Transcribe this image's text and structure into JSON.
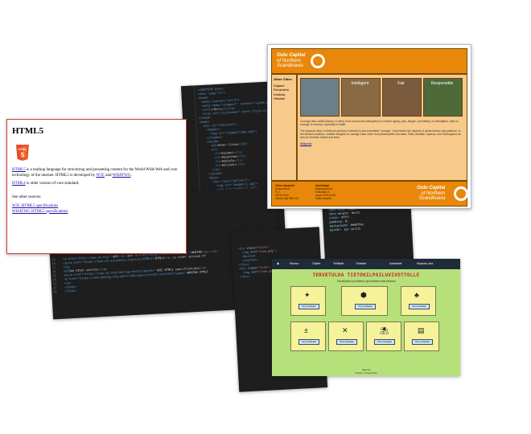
{
  "code_back": {
    "lines": [
      "<!DOCTYPE html>",
      "<html lang=\"fi\">",
      "<head>",
      "  <meta charset=\"utf-8\">",
      "  <meta name=\"viewport\" content=\"width=device-width\">",
      "  <title>Oulu</title>",
      "  <link rel=\"stylesheet\" href=\"style.css\">",
      "</head>",
      "<body>",
      "  <div id=\"container\">",
      "    <header>",
      "      <img src=\"images/logo.png\">",
      "    </header>",
      "    <aside>",
      "      <h2>Other Cities</h2>",
      "      <ul>",
      "        <li>Kajaani</li>",
      "        <li>Rovaniemi</li>",
      "        <li>Kokkola</li>",
      "        <li>Helsinki</li>",
      "      </ul>",
      "    </aside>",
      "    <main>",
      "      <div class=\"gallery\">",
      "        <img src=\"images/1.jpg\">",
      "        <img src=\"images/2.jpg\">",
      "      </div>",
      "    </main>",
      "  </div>",
      "</body>",
      "</html>"
    ]
  },
  "code_front": {
    "lines": [
      "<a href=\"http://www.w3.org/\">W3C</a> and <a href=\"http://www.whatwg.org/\">WHATWG</a>.</p>",
      "<p><a href=\"https://www.en.wikipedia.org/wiki/HTML4\">HTML4</a> is older version of",
      "</p>",
      "<p>See other sources:</p>",
      "<p><a href=\"https://www.w3.org/html/wg/drafts/master\">W3C HTML5 specifications</a>",
      "<a href=\"https://www.whatwg.org/specs/web-apps/current-work/multipage\">WHATWG HTML5",
      "</p>",
      "</body>",
      "</html>"
    ],
    "numbers": [
      "15",
      "16",
      "17",
      "18",
      "19",
      "20",
      "21",
      "22",
      "23"
    ]
  },
  "html5_doc": {
    "title": "HTML5",
    "para1_link": "HTML5",
    "para1": " is a markup language for structuring and presenting content for the World Wide Web and core technology of the internet. HTML5 is developed by ",
    "w3c": "W3C",
    "and": " and ",
    "whatwg": "WHATWG",
    "para2_link": "HTML4",
    "para2": " is older version of core standard.",
    "para3": "See other sources:",
    "link1": "W3C HTML5 specifications",
    "link2": "WHATWG HTML5 specifications"
  },
  "oulu": {
    "title_line1": "Oulu Capital",
    "title_line2": "of Northern",
    "title_line3": "Scandinavia",
    "sidebar_heading": "Other Cities",
    "cities": [
      "Kajaani",
      "Rovaniemi",
      "Kokkola",
      "Helsinki"
    ],
    "photos": [
      {
        "caption": "",
        "color": "#6a7f8a"
      },
      {
        "caption": "Intelligent",
        "color": "#8a6a45"
      },
      {
        "caption": "Fair",
        "color": "#7b5b3e"
      },
      {
        "caption": "Responsible",
        "color": "#4e6a38"
      }
    ],
    "text1": "Courage (also called bravery or valor) is the choice and willingness to confront agony, pain, danger, uncertainty, or intimidation. Valor is courage or bravery, especially in battle.",
    "text2": "The classical virtue of fortitude (andreia, fortitudo) is also translated \"courage\", but includes the aspects of perseverance and patience. In the Western tradition, notable thoughts on courage have come from philosophers Socrates, Plato, Aristotle, Aquinas, and Kierkegaard; as well as Christian beliefs and texts.",
    "link": "Wikipedia",
    "footer_col1": [
      "Oulun kaupunki",
      "Kaupunkisuu",
      "PL 1",
      "90015 Oulu",
      "Vaihde (08) 558 410"
    ],
    "footer_col2": [
      "Aukioloajat",
      "Asiakaspalvelu",
      "Kirkkokatu 2",
      "ma-pe 8.00-16.00",
      "Katso kartalta"
    ],
    "footer_logo_line1": "Oulu Capital",
    "footer_logo_line2": "of Northern",
    "footer_logo_line3": "Scandinavia"
  },
  "green": {
    "nav": [
      "Etusivu",
      "Ohjeet",
      "Tehtävät",
      "Tulokset",
      "Asetukset",
      "Kirjaudu ulos"
    ],
    "title": "TERVETULOA TIETOKILPAILUVIVOTTOLLE",
    "subtitle": "Tietokilpailut ja tehtäviä, ajanvietteet sekä tietoiset",
    "tiles": [
      {
        "icon": "✦",
        "button": "Siirry tehtävään"
      },
      {
        "icon": "⬢",
        "button": "Siirry tehtävään"
      },
      {
        "icon": "♣",
        "button": "Siirry tehtävään"
      },
      {
        "icon": "±",
        "button": "Siirry tehtävään"
      },
      {
        "icon": "✕",
        "button": "Siirry tehtävään"
      },
      {
        "icon": "⛱",
        "button": "Siirry tehtävään"
      },
      {
        "icon": "▤",
        "button": "Siirry tehtävään"
      }
    ],
    "footer_line1": "Hakuna",
    "footer_line2": "Tietoja | Yhteystiedot"
  }
}
